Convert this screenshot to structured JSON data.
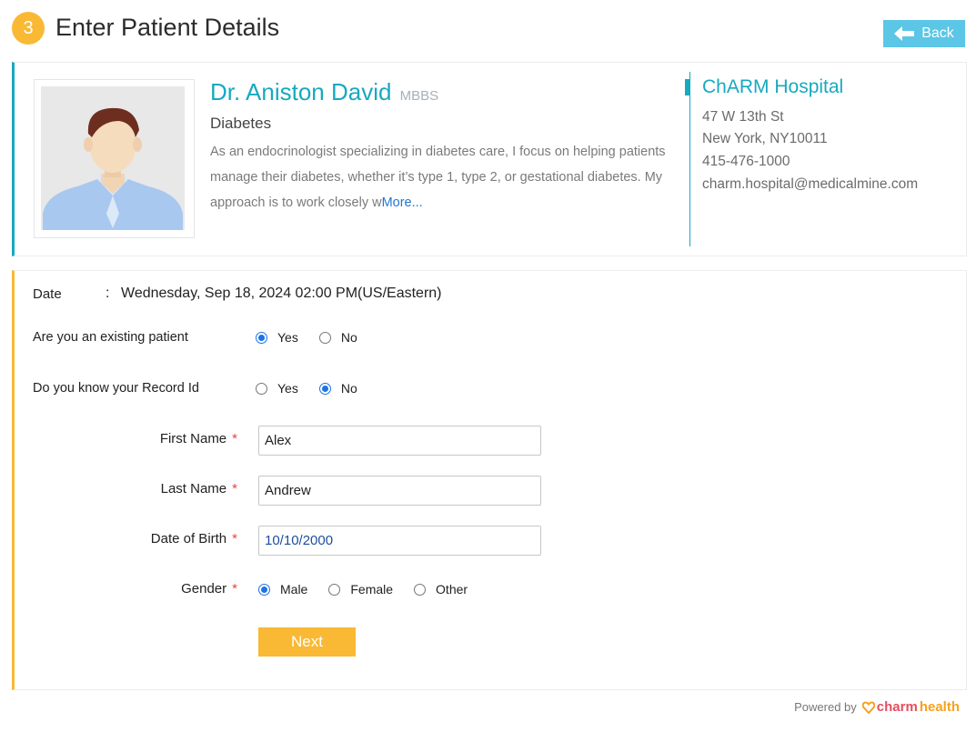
{
  "header": {
    "step_number": "3",
    "title": "Enter Patient Details",
    "back_label": "Back"
  },
  "doctor": {
    "name": "Dr. Aniston David",
    "degree": "MBBS",
    "specialty": "Diabetes",
    "bio": "As an endocrinologist specializing in diabetes care, I focus on helping patients manage their diabetes, whether it’s type 1, type 2, or gestational diabetes. My approach is to work closely w",
    "more_label": "More..."
  },
  "hospital": {
    "name": "ChARM Hospital",
    "address_line1": "47 W 13th St",
    "address_line2": "New York, NY10011",
    "phone": "415-476-1000",
    "email": "charm.hospital@medicalmine.com"
  },
  "form": {
    "date_label": "Date",
    "date_colon": ":",
    "date_value": "Wednesday, Sep 18, 2024 02:00 PM(US/Eastern)",
    "existing_patient": {
      "label": "Are you an existing patient",
      "options": [
        "Yes",
        "No"
      ],
      "selected": "Yes"
    },
    "know_record_id": {
      "label": "Do you know your Record Id",
      "options": [
        "Yes",
        "No"
      ],
      "selected": "No"
    },
    "required_mark": "*",
    "first_name": {
      "label": "First Name",
      "value": "Alex"
    },
    "last_name": {
      "label": "Last Name",
      "value": "Andrew"
    },
    "dob": {
      "label": "Date of Birth",
      "value": "10/10/2000"
    },
    "gender": {
      "label": "Gender",
      "options": [
        "Male",
        "Female",
        "Other"
      ],
      "selected": "Male"
    },
    "next_label": "Next"
  },
  "footer": {
    "powered_by": "Powered by",
    "brand_part1": "charm",
    "brand_part2": "health"
  },
  "colors": {
    "accent_teal": "#17a9c0",
    "accent_orange": "#f9b934",
    "back_button": "#5bc6e6",
    "link_blue": "#1f78d1",
    "required_red": "#e2463c"
  },
  "icons": {
    "back": "arrow-left-icon",
    "doctor_photo": "doctor-avatar-icon",
    "brand_logo": "charmhealth-heart-icon"
  }
}
